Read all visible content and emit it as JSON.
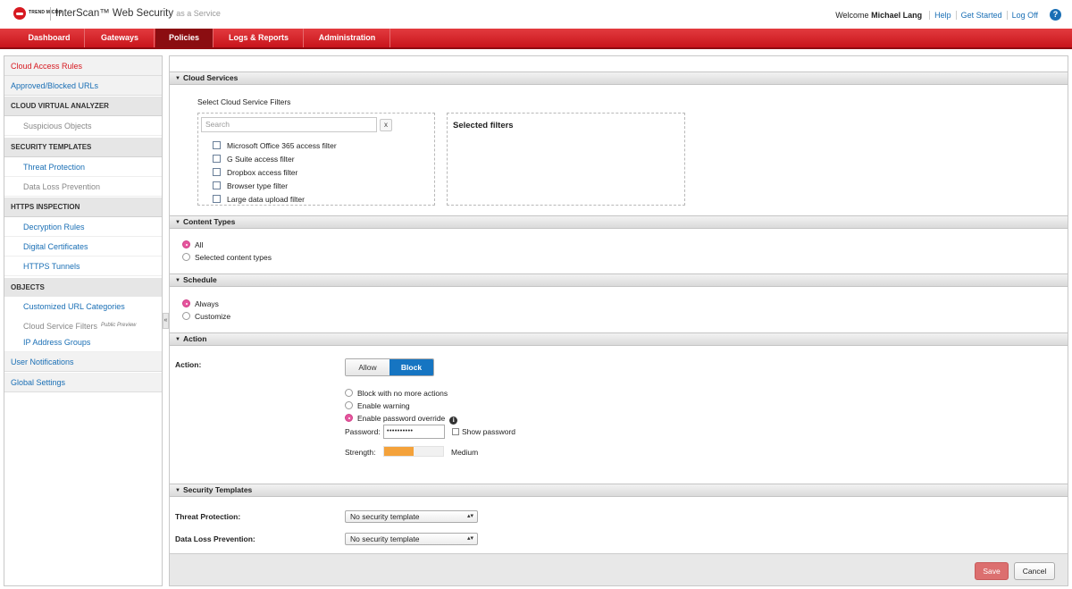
{
  "header": {
    "brand": "TREND MICRO",
    "product": "InterScan™ Web Security",
    "product_suffix": "as a Service",
    "welcome_prefix": "Welcome",
    "user_name": "Michael Lang",
    "links": [
      "Help",
      "Get Started",
      "Log Off"
    ],
    "help_glyph": "?"
  },
  "nav": {
    "tabs": [
      "Dashboard",
      "Gateways",
      "Policies",
      "Logs & Reports",
      "Administration"
    ],
    "active": "Policies"
  },
  "sidebar": {
    "cloud_access_rules": "Cloud Access Rules",
    "approved_blocked_urls": "Approved/Blocked URLs",
    "cloud_virtual_analyzer": "CLOUD VIRTUAL ANALYZER",
    "suspicious_objects": "Suspicious Objects",
    "security_templates": "SECURITY TEMPLATES",
    "threat_protection": "Threat Protection",
    "data_loss_prevention": "Data Loss Prevention",
    "https_inspection": "HTTPS INSPECTION",
    "decryption_rules": "Decryption Rules",
    "digital_certificates": "Digital Certificates",
    "https_tunnels": "HTTPS Tunnels",
    "objects": "OBJECTS",
    "customized_url_categories": "Customized URL Categories",
    "cloud_service_filters": "Cloud Service Filters",
    "public_preview": "Public Preview",
    "ip_address_groups": "IP Address Groups",
    "user_notifications": "User Notifications",
    "global_settings": "Global Settings",
    "collapse_glyph": "«"
  },
  "cloud_services": {
    "title": "Cloud Services",
    "select_label": "Select Cloud Service Filters",
    "search_placeholder": "Search",
    "clear_glyph": "x",
    "filters": [
      "Microsoft Office 365 access filter",
      "G Suite access filter",
      "Dropbox access filter",
      "Browser type filter",
      "Large data upload filter"
    ],
    "selected_title": "Selected filters"
  },
  "content_types": {
    "title": "Content Types",
    "options": [
      "All",
      "Selected content types"
    ],
    "selected": "All"
  },
  "schedule": {
    "title": "Schedule",
    "options": [
      "Always",
      "Customize"
    ],
    "selected": "Always"
  },
  "action": {
    "title": "Action",
    "label": "Action:",
    "allow_label": "Allow",
    "block_label": "Block",
    "mode": "Block",
    "options": [
      "Block with no more actions",
      "Enable warning",
      "Enable password override"
    ],
    "selected": "Enable password override",
    "password_label": "Password:",
    "password_value": "••••••••••",
    "show_password": "Show password",
    "strength_label": "Strength:",
    "strength_value": "Medium",
    "strength_fraction": 0.5,
    "info_glyph": "i"
  },
  "security_templates": {
    "title": "Security Templates",
    "threat_protection_label": "Threat Protection:",
    "threat_protection_value": "No security template",
    "dlp_label": "Data Loss Prevention:",
    "dlp_value": "No security template"
  },
  "footer": {
    "save": "Save",
    "cancel": "Cancel"
  },
  "colors": {
    "brand_red": "#d71920",
    "link_blue": "#1a6fb5",
    "active_segment": "#1675c2",
    "radio_selected": "#e6569e",
    "strength_medium": "#f4a23b"
  }
}
